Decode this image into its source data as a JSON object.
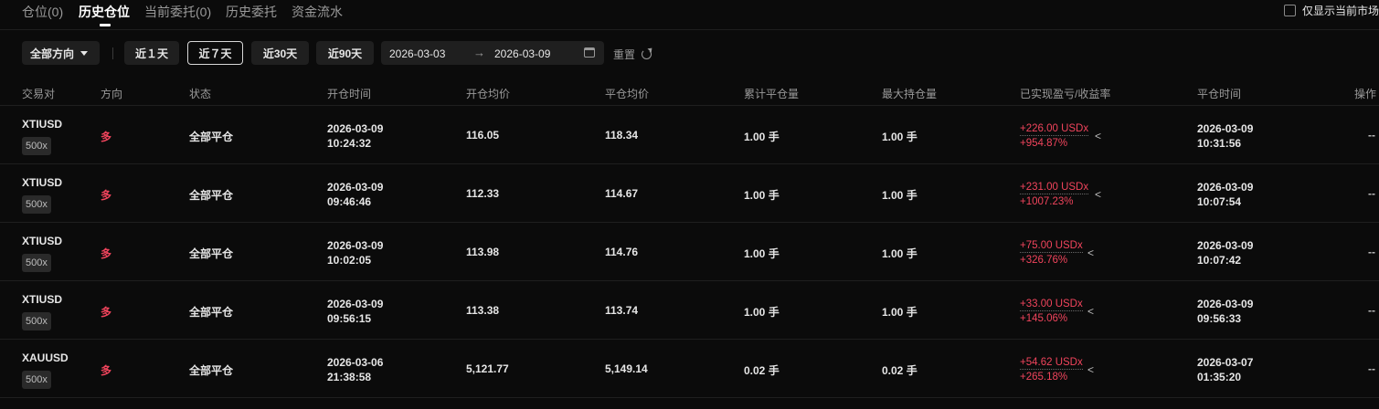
{
  "tabs": [
    "仓位(0)",
    "历史仓位",
    "当前委托(0)",
    "历史委托",
    "资金流水"
  ],
  "only_current_label": "仅显示当前市场",
  "toolbar": {
    "direction": "全部方向",
    "ranges": [
      "近１天",
      "近７天",
      "近30天",
      "近90天"
    ],
    "active_range": "近７天",
    "date_start": "2026-03-03",
    "date_arrow": "→",
    "date_end": "2026-03-09",
    "reset": "重置"
  },
  "columns": [
    "交易对",
    "方向",
    "状态",
    "开仓时间",
    "开仓均价",
    "平仓均价",
    "累计平仓量",
    "最大持仓量",
    "已实现盈亏/收益率",
    "平仓时间",
    "操作"
  ],
  "rows": [
    {
      "symbol": "XTIUSD",
      "leverage": "500x",
      "direction": "多",
      "status": "全部平仓",
      "open_date": "2026-03-09",
      "open_time": "10:24:32",
      "open_price": "116.05",
      "close_price": "118.34",
      "acc_close": "1.00 手",
      "max_pos": "1.00 手",
      "pnl": "+226.00 USDx",
      "roi": "+954.87%",
      "close_date": "2026-03-09",
      "close_time": "10:31:56",
      "op": "--"
    },
    {
      "symbol": "XTIUSD",
      "leverage": "500x",
      "direction": "多",
      "status": "全部平仓",
      "open_date": "2026-03-09",
      "open_time": "09:46:46",
      "open_price": "112.33",
      "close_price": "114.67",
      "acc_close": "1.00 手",
      "max_pos": "1.00 手",
      "pnl": "+231.00 USDx",
      "roi": "+1007.23%",
      "close_date": "2026-03-09",
      "close_time": "10:07:54",
      "op": "--"
    },
    {
      "symbol": "XTIUSD",
      "leverage": "500x",
      "direction": "多",
      "status": "全部平仓",
      "open_date": "2026-03-09",
      "open_time": "10:02:05",
      "open_price": "113.98",
      "close_price": "114.76",
      "acc_close": "1.00 手",
      "max_pos": "1.00 手",
      "pnl": "+75.00 USDx",
      "roi": "+326.76%",
      "close_date": "2026-03-09",
      "close_time": "10:07:42",
      "op": "--"
    },
    {
      "symbol": "XTIUSD",
      "leverage": "500x",
      "direction": "多",
      "status": "全部平仓",
      "open_date": "2026-03-09",
      "open_time": "09:56:15",
      "open_price": "113.38",
      "close_price": "113.74",
      "acc_close": "1.00 手",
      "max_pos": "1.00 手",
      "pnl": "+33.00 USDx",
      "roi": "+145.06%",
      "close_date": "2026-03-09",
      "close_time": "09:56:33",
      "op": "--"
    },
    {
      "symbol": "XAUUSD",
      "leverage": "500x",
      "direction": "多",
      "status": "全部平仓",
      "open_date": "2026-03-06",
      "open_time": "21:38:58",
      "open_price": "5,121.77",
      "close_price": "5,149.14",
      "acc_close": "0.02 手",
      "max_pos": "0.02 手",
      "pnl": "+54.62 USDx",
      "roi": "+265.18%",
      "close_date": "2026-03-07",
      "close_time": "01:35:20",
      "op": "--"
    }
  ],
  "colors": {
    "background": "#0b0b0b",
    "profit": "#f0445c",
    "muted": "#9a9a9a"
  },
  "icons": {
    "share": "share-icon",
    "calendar": "calendar-icon",
    "refresh": "refresh-icon",
    "caret": "chevron-down-icon"
  }
}
